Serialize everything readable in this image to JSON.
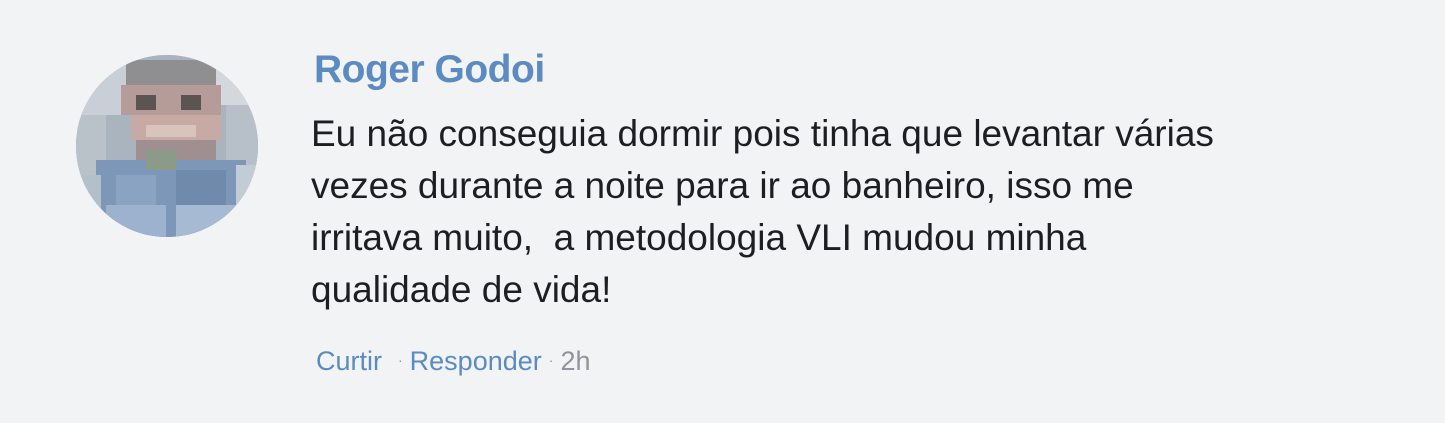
{
  "comment": {
    "author": "Roger Godoi",
    "text_lines": [
      "Eu não conseguia dormir pois tinha que levantar várias",
      "vezes durante a noite para ir ao banheiro, isso me",
      "irritava muito,  a metodologia VLI mudou minha",
      "qualidade de vida!"
    ],
    "actions": {
      "like_label": "Curtir",
      "reply_label": "Responder",
      "separator": "·",
      "timestamp": "2h"
    }
  },
  "colors": {
    "background": "#f2f3f5",
    "author": "#5b8bc0",
    "link": "#5b8bc0",
    "text": "#1c1e21",
    "muted": "#90949c"
  },
  "avatar": {
    "icon": "pixelated-profile-photo"
  }
}
